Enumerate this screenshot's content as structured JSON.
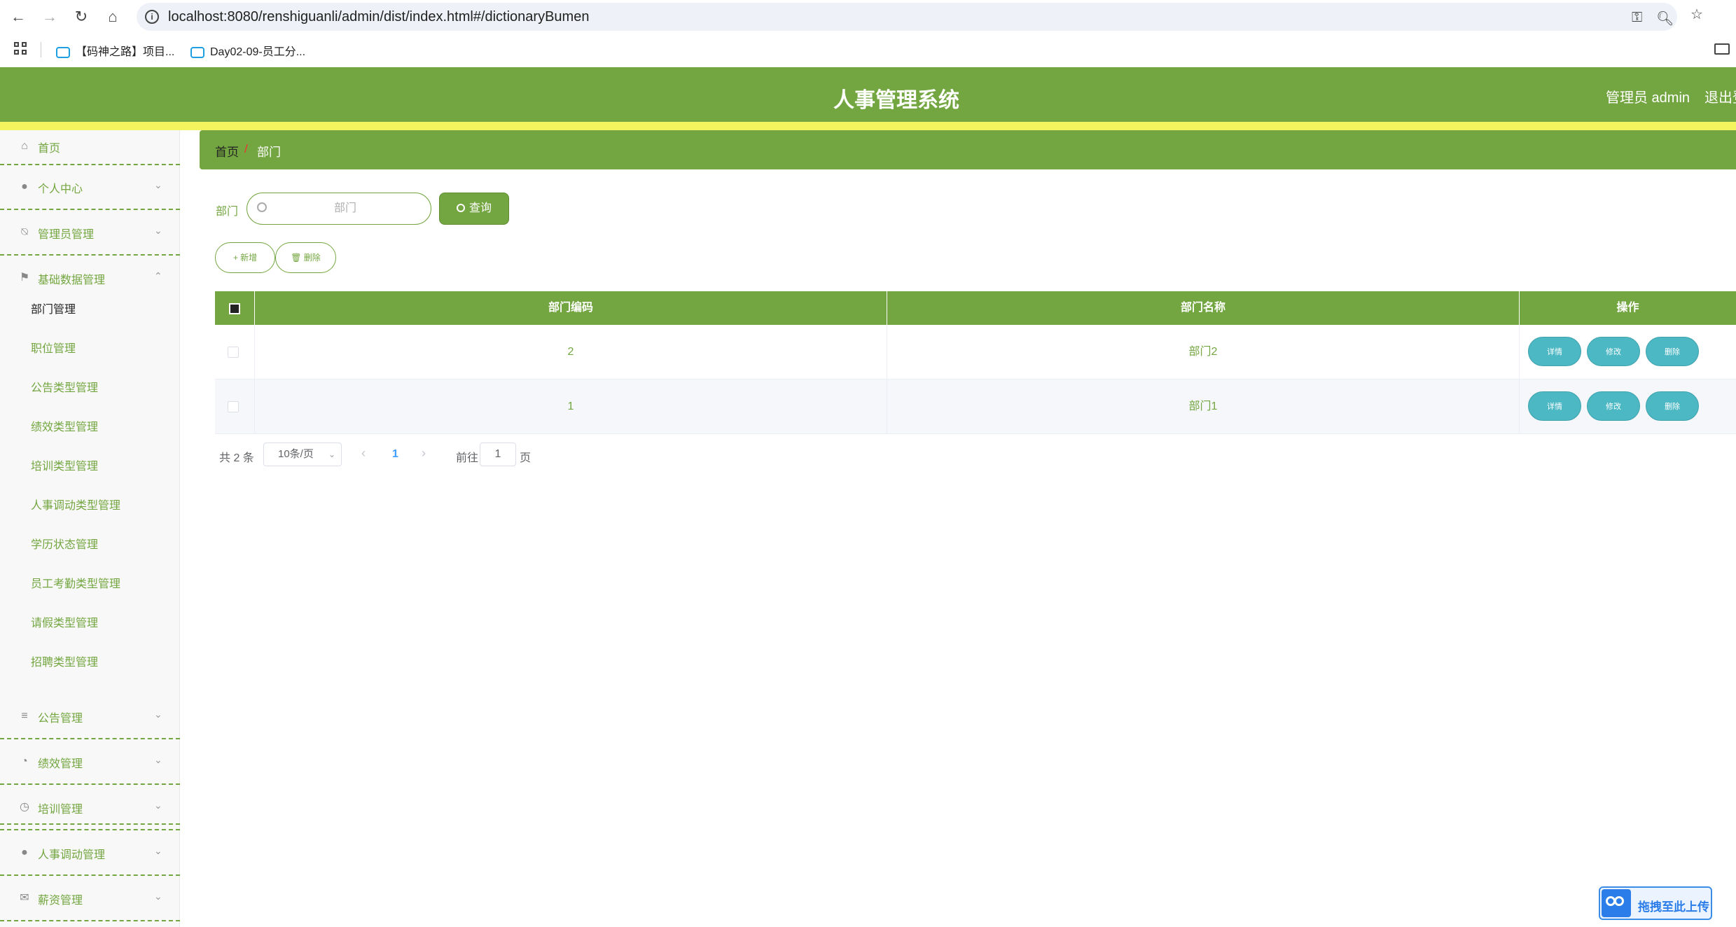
{
  "browser": {
    "url": "localhost:8080/renshiguanli/admin/dist/index.html#/dictionaryBumen",
    "bookmarks": [
      "【码神之路】项目...",
      "Day02-09-员工分..."
    ]
  },
  "header": {
    "title": "人事管理系统",
    "admin": "管理员 admin",
    "logout": "退出登录"
  },
  "sidebar": {
    "home": "首页",
    "menus": [
      {
        "label": "个人中心"
      },
      {
        "label": "管理员管理"
      },
      {
        "label": "基础数据管理"
      }
    ],
    "sub_items": [
      "部门管理",
      "职位管理",
      "公告类型管理",
      "绩效类型管理",
      "培训类型管理",
      "人事调动类型管理",
      "学历状态管理",
      "员工考勤类型管理",
      "请假类型管理",
      "招聘类型管理"
    ],
    "menus_after": [
      {
        "label": "公告管理"
      },
      {
        "label": "绩效管理"
      },
      {
        "label": "培训管理"
      },
      {
        "label": "人事调动管理"
      },
      {
        "label": "薪资管理"
      }
    ]
  },
  "breadcrumb": {
    "home": "首页",
    "separator": "/",
    "current": "部门"
  },
  "search": {
    "label": "部门",
    "placeholder": "部门",
    "button": "查询"
  },
  "toolbar": {
    "add": "+ 新增",
    "delete": "删除"
  },
  "table": {
    "headers": [
      "部门编码",
      "部门名称",
      "操作"
    ],
    "rows": [
      {
        "code": "2",
        "name": "部门2"
      },
      {
        "code": "1",
        "name": "部门1"
      }
    ],
    "actions": {
      "detail": "详情",
      "edit": "修改",
      "delete": "删除"
    }
  },
  "pagination": {
    "total": "共 2 条",
    "page_size": "10条/页",
    "current": "1",
    "goto_label": "前往",
    "goto_value": "1",
    "page_suffix": "页"
  },
  "upload": {
    "label": "拖拽至此上传"
  },
  "colors": {
    "primary": "#73a640",
    "stripe": "#f4f45e",
    "action": "#4cb8c4"
  }
}
